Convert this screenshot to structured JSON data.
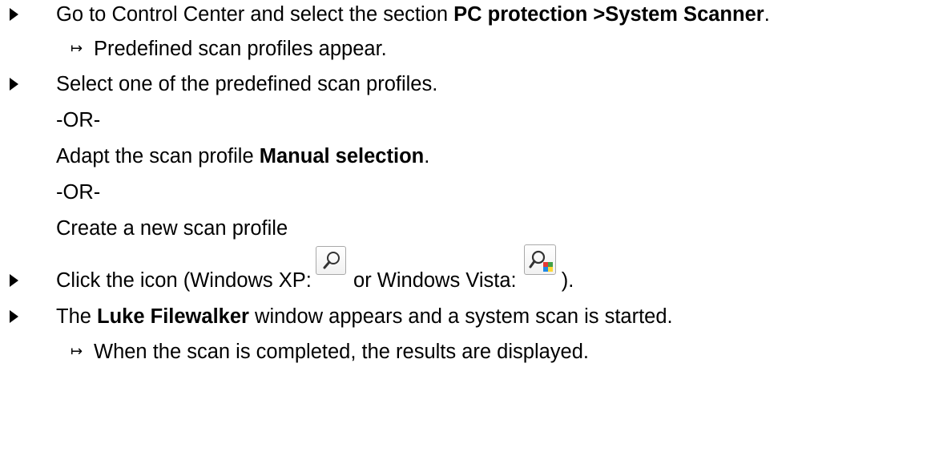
{
  "steps": [
    {
      "pre": "Go to Control Center and select the section ",
      "bold": "PC protection >System Scanner",
      "post": "."
    },
    {
      "result": "Predefined scan profiles appear."
    },
    {
      "text": "Select one of the predefined scan profiles."
    },
    {
      "text": "-OR-"
    },
    {
      "pre": "Adapt the scan profile ",
      "bold": "Manual selection",
      "post": "."
    },
    {
      "text": "-OR-"
    },
    {
      "text": "Create a new scan profile"
    },
    {
      "pre": "Click the icon (Windows XP: ",
      "mid": " or Windows Vista: ",
      "post": " )."
    },
    {
      "pre": "The ",
      "bold": "Luke Filewalker",
      "post": " window appears and a system scan is started."
    },
    {
      "result": "When the scan is completed, the results are displayed."
    }
  ],
  "icons": {
    "xp": "search-icon",
    "vista": "search-vista-icon",
    "bullet": "triangle-bullet-icon",
    "result_arrow": "result-arrow-icon"
  },
  "colors": {
    "text": "#000000",
    "icon_border": "#a9a9a9",
    "vista_red": "#e53935",
    "vista_green": "#43a047",
    "vista_yellow": "#fdd835",
    "vista_blue": "#1e88e5"
  }
}
